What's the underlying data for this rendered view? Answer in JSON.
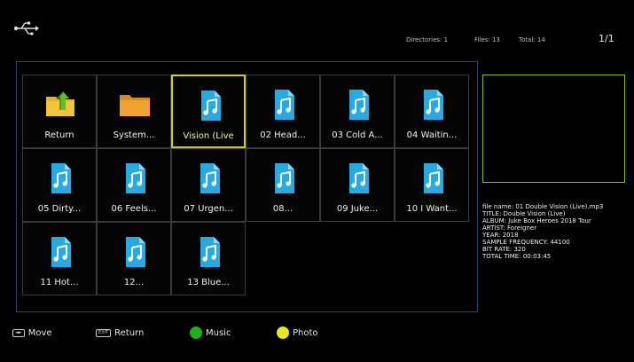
{
  "status": {
    "directories": "Directories: 1",
    "files": "Files: 13",
    "total": "Total: 14",
    "page": "1/1"
  },
  "grid": {
    "items": [
      {
        "label": "Return",
        "type": "return"
      },
      {
        "label": "System...",
        "type": "folder"
      },
      {
        "label": "Vision (Live",
        "type": "music",
        "selected": true
      },
      {
        "label": "02 Head...",
        "type": "music"
      },
      {
        "label": "03 Cold A...",
        "type": "music"
      },
      {
        "label": "04 Waitin...",
        "type": "music"
      },
      {
        "label": "05 Dirty...",
        "type": "music"
      },
      {
        "label": "06 Feels...",
        "type": "music"
      },
      {
        "label": "07 Urgen...",
        "type": "music"
      },
      {
        "label": "08...",
        "type": "music"
      },
      {
        "label": "09 Juke...",
        "type": "music"
      },
      {
        "label": "10 I Want...",
        "type": "music"
      },
      {
        "label": "11 Hot...",
        "type": "music"
      },
      {
        "label": "12...",
        "type": "music"
      },
      {
        "label": "13 Blue...",
        "type": "music"
      }
    ]
  },
  "details": {
    "file_name": "file name: 01 Double Vision (Live).mp3",
    "title": "TITLE: Double Vision (Live)",
    "album": "ALBUM: Juke Box Heroes 2018 Tour",
    "artist": "ARTIST: Foreigner",
    "year": "YEAR: 2018",
    "sample_frequency": "SAMPLE FREQUENCY: 44100",
    "bit_rate": "BIT RATE: 320",
    "total_time": "TOTAL TIME: 00:03:45"
  },
  "footer": {
    "move_key": "◄►",
    "move_label": "Move",
    "return_key": "EXIT",
    "return_label": "Return",
    "music_label": "Music",
    "photo_label": "Photo"
  },
  "colors": {
    "selection": "#d1d112",
    "frame_border": "#28457a",
    "preview_border": "#8fbc2e",
    "music_dot": "#1db31d",
    "photo_dot": "#e8e81a",
    "music_icon": "#27a9e1"
  }
}
